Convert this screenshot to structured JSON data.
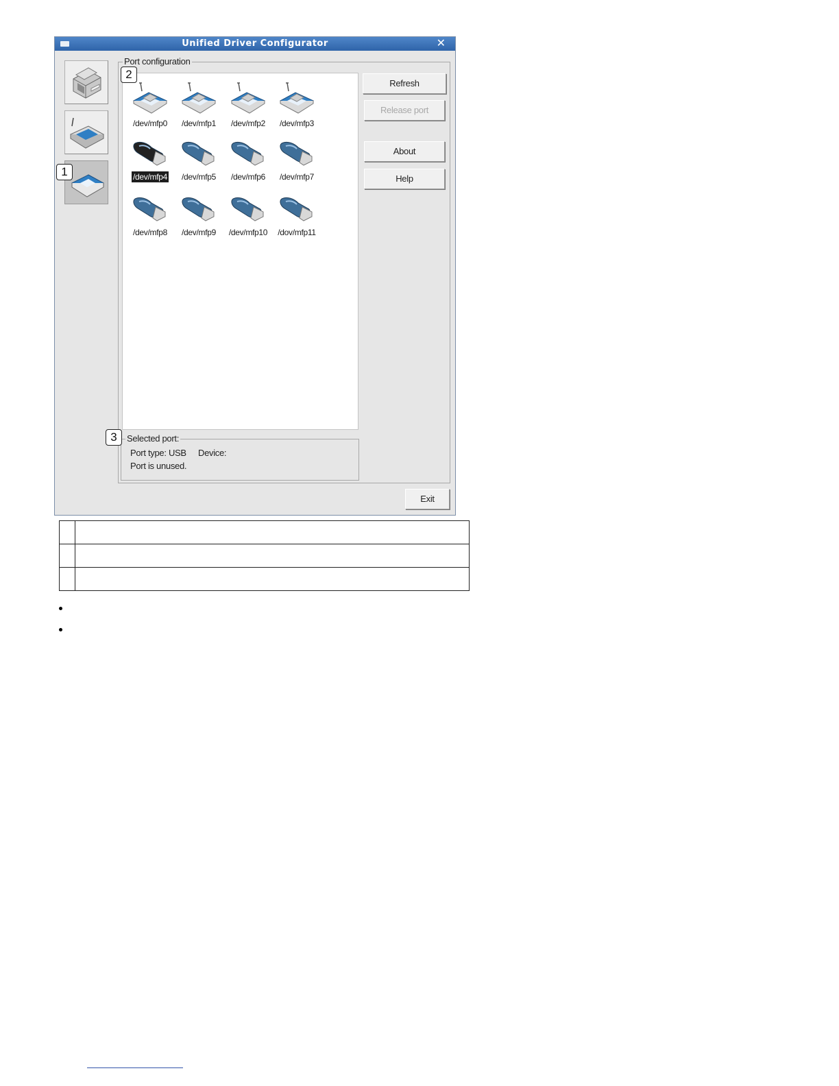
{
  "window": {
    "title": "Unified Driver Configurator",
    "close_glyph": "✕"
  },
  "categories": [
    {
      "name": "printers-configuration",
      "icon": "printer-icon",
      "selected": false
    },
    {
      "name": "scanners-configuration",
      "icon": "scanner-icon",
      "selected": false
    },
    {
      "name": "ports-configuration",
      "icon": "port-icon",
      "selected": true
    }
  ],
  "callouts": {
    "one": "1",
    "two": "2",
    "three": "3"
  },
  "port_configuration": {
    "label": "Port configuration",
    "ports": [
      {
        "label": "/dev/mfp0",
        "type": "parallel",
        "selected": false
      },
      {
        "label": "/dev/mfp1",
        "type": "parallel",
        "selected": false
      },
      {
        "label": "/dev/mfp2",
        "type": "parallel",
        "selected": false
      },
      {
        "label": "/dev/mfp3",
        "type": "parallel",
        "selected": false
      },
      {
        "label": "/dev/mfp4",
        "type": "usb",
        "selected": true
      },
      {
        "label": "/dev/mfp5",
        "type": "usb",
        "selected": false
      },
      {
        "label": "/dev/mfp6",
        "type": "usb",
        "selected": false
      },
      {
        "label": "/dev/mfp7",
        "type": "usb",
        "selected": false
      },
      {
        "label": "/dev/mfp8",
        "type": "usb",
        "selected": false
      },
      {
        "label": "/dev/mfp9",
        "type": "usb",
        "selected": false
      },
      {
        "label": "/dev/mfp10",
        "type": "usb",
        "selected": false
      },
      {
        "label": "/dov/mfp11",
        "type": "usb",
        "selected": false
      }
    ]
  },
  "buttons": {
    "refresh": "Refresh",
    "release_port": "Release port",
    "about": "About",
    "help": "Help",
    "exit": "Exit"
  },
  "selected_port": {
    "label": "Selected port:",
    "port_type": "Port type: USB",
    "device": "Device:",
    "status": "Port is unused."
  },
  "colors": {
    "titlebar": "#3b72b8",
    "parallel_connector": "#2f7fc4",
    "usb_connector": "#3f6f99",
    "usb_selected": "#222222"
  }
}
